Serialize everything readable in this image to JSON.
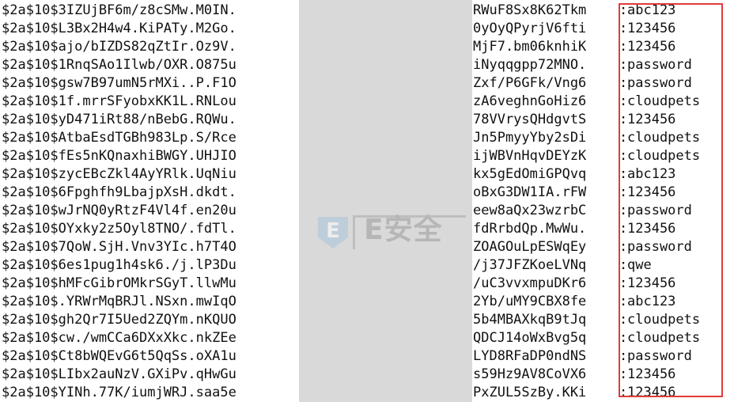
{
  "colors": {
    "highlight_border": "#e23b3b",
    "redaction": "#d9d9d9",
    "text": "#111111"
  },
  "separator": ":",
  "watermark": {
    "logo_letter": "E",
    "text": "E安全"
  },
  "rows": [
    {
      "left": "$2a$10$3IZUjBF6m/z8cSMw.M0IN.",
      "right": "RWuF8Sx8K62Tkm",
      "password": "abc123"
    },
    {
      "left": "$2a$10$L3Bx2H4w4.KiPATy.M2Go.",
      "right": "0yOyQPyrjV6fti",
      "password": "123456"
    },
    {
      "left": "$2a$10$ajo/bIZDS82qZtIr.Oz9V.",
      "right": "MjF7.bm06knhiK",
      "password": "123456"
    },
    {
      "left": "$2a$10$1RnqSAo1Ilwb/OXR.O875u",
      "right": "iNyqqgpp72MNO.",
      "password": "password"
    },
    {
      "left": "$2a$10$gsw7B97umN5rMXi..P.F1O",
      "right": "Zxf/P6GFk/Vng6",
      "password": "password"
    },
    {
      "left": "$2a$10$1f.mrrSFyobxKK1L.RNLou",
      "right": "zA6veghnGoHiz6",
      "password": "cloudpets"
    },
    {
      "left": "$2a$10$yD471iRt88/nBebG.RQWu.",
      "right": "78VVrysQHdgvtS",
      "password": "123456"
    },
    {
      "left": "$2a$10$AtbaEsdTGBh983Lp.S/Rce",
      "right": "Jn5PmyyYby2sDi",
      "password": "cloudpets"
    },
    {
      "left": "$2a$10$fEs5nKQnaxhiBWGY.UHJIO",
      "right": "ijWBVnHqvDEYzK",
      "password": "cloudpets"
    },
    {
      "left": "$2a$10$zycEBcZkl4AyYRlk.UqNiu",
      "right": "kx5gEdOmiGPQvq",
      "password": "abc123"
    },
    {
      "left": "$2a$10$6Fpghfh9LbajpXsH.dkdt.",
      "right": "oBxG3DW1IA.rFW",
      "password": "123456"
    },
    {
      "left": "$2a$10$wJrNQ0yRtzF4Vl4f.en20u",
      "right": "eew8aQx23wzrbC",
      "password": "password"
    },
    {
      "left": "$2a$10$OYxky2z5Oyl8TNO/.fdTl.",
      "right": "fdRrbdQp.MwWu.",
      "password": "123456"
    },
    {
      "left": "$2a$10$7QoW.SjH.Vnv3YIc.h7T4O",
      "right": "ZOAGOuLpESWqEy",
      "password": "password"
    },
    {
      "left": "$2a$10$6es1pug1h4sk6./j.lP3Du",
      "right": "/j37JFZKoeLVNq",
      "password": "qwe"
    },
    {
      "left": "$2a$10$hMFcGibrOMkrSGyT.llwMu",
      "right": "/uC3vvxmpuDKr6",
      "password": "123456"
    },
    {
      "left": "$2a$10$.YRWrMqBRJl.NSxn.mwIqO",
      "right": "2Yb/uMY9CBX8fe",
      "password": "abc123"
    },
    {
      "left": "$2a$10$gh2Qr7I5Ued2ZQYm.nKQUO",
      "right": "5b4MBAXkqB9tJq",
      "password": "cloudpets"
    },
    {
      "left": "$2a$10$cw./wmCCa6DXxXkc.nkZEe",
      "right": "QDCJ14oWxBvg5q",
      "password": "cloudpets"
    },
    {
      "left": "$2a$10$Ct8bWQEvG6t5QqSs.oXA1u",
      "right": "LYD8RFaDP0ndNS",
      "password": "password"
    },
    {
      "left": "$2a$10$LIbx2auNzV.GXiPv.qHwGu",
      "right": "s59Hz9AV8CoVX6",
      "password": "123456"
    },
    {
      "left": "$2a$10$YINh.77K/iumjWRJ.saa5e",
      "right": "PxZUL5SzBy.KKi",
      "password": "123456"
    }
  ]
}
